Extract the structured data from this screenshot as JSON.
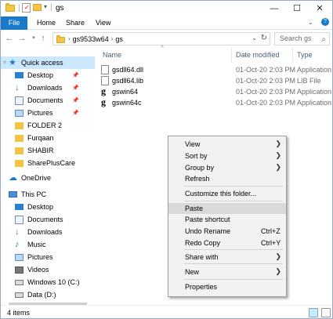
{
  "window": {
    "title": "gs",
    "controls": {
      "minimize": "—",
      "maximize": "☐",
      "close": "✕"
    }
  },
  "ribbon": {
    "tabs": [
      "File",
      "Home",
      "Share",
      "View"
    ]
  },
  "address": {
    "crumbs": [
      "gs9533w64",
      "gs"
    ],
    "search_placeholder": "Search gs"
  },
  "nav": {
    "items": [
      {
        "label": "Quick access",
        "icon": "star-icon",
        "selected": true
      },
      {
        "label": "Desktop",
        "icon": "desktop-icon",
        "pinned": true
      },
      {
        "label": "Downloads",
        "icon": "download-icon",
        "pinned": true
      },
      {
        "label": "Documents",
        "icon": "documents-icon",
        "pinned": true
      },
      {
        "label": "Pictures",
        "icon": "pictures-icon",
        "pinned": true
      },
      {
        "label": "FOLDER 2",
        "icon": "folder-icon"
      },
      {
        "label": "Furqaan",
        "icon": "folder-icon"
      },
      {
        "label": "SHABIR",
        "icon": "folder-icon"
      },
      {
        "label": "SharePlusCare",
        "icon": "folder-icon"
      },
      {
        "label": "OneDrive",
        "icon": "cloud-icon"
      },
      {
        "label": "This PC",
        "icon": "computer-icon"
      },
      {
        "label": "Desktop",
        "icon": "desktop-icon"
      },
      {
        "label": "Documents",
        "icon": "documents-icon"
      },
      {
        "label": "Downloads",
        "icon": "download-icon"
      },
      {
        "label": "Music",
        "icon": "music-icon"
      },
      {
        "label": "Pictures",
        "icon": "pictures-icon"
      },
      {
        "label": "Videos",
        "icon": "videos-icon"
      },
      {
        "label": "Windows 10 (C:)",
        "icon": "drive-icon"
      },
      {
        "label": "Data (D:)",
        "icon": "drive-icon"
      }
    ]
  },
  "columns": {
    "name": "Name",
    "date": "Date modified",
    "type": "Type"
  },
  "files": [
    {
      "name": "gsdll64.dll",
      "date": "01-Oct-20 2:03 PM",
      "type": "Application e",
      "icon": "dll-file-icon"
    },
    {
      "name": "gsdll64.lib",
      "date": "01-Oct-20 2:03 PM",
      "type": "LIB File",
      "icon": "lib-file-icon"
    },
    {
      "name": "gswin64",
      "date": "01-Oct-20 2:03 PM",
      "type": "Application",
      "icon": "ghostscript-icon"
    },
    {
      "name": "gswin64c",
      "date": "01-Oct-20 2:03 PM",
      "type": "Application",
      "icon": "ghostscript-icon"
    }
  ],
  "status": {
    "count": "4 items"
  },
  "context_menu": {
    "view": "View",
    "sort_by": "Sort by",
    "group_by": "Group by",
    "refresh": "Refresh",
    "customize": "Customize this folder...",
    "paste": "Paste",
    "paste_shortcut": "Paste shortcut",
    "undo_rename": "Undo Rename",
    "undo_shortcut": "Ctrl+Z",
    "redo_copy": "Redo Copy",
    "redo_shortcut": "Ctrl+Y",
    "share_with": "Share with",
    "new": "New",
    "properties": "Properties"
  },
  "colors": {
    "accent": "#1979ca",
    "selection": "#cce8ff",
    "folder": "#f4c542"
  }
}
